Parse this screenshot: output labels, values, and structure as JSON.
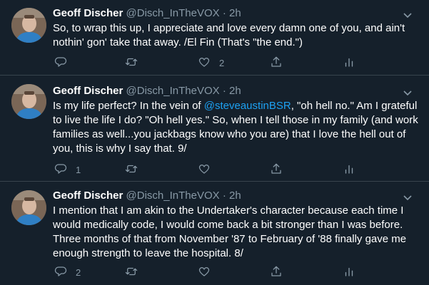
{
  "tweets": [
    {
      "name": "Geoff Discher",
      "handle": "@Disch_InTheVOX",
      "dot": "·",
      "time": "2h",
      "text": "So, to wrap this up, I appreciate and love every damn one of you, and ain't nothin' gon' take that away. /El Fin (That's \"the end.\")",
      "reply_count": "",
      "retweet_count": "",
      "like_count": "2"
    },
    {
      "name": "Geoff Discher",
      "handle": "@Disch_InTheVOX",
      "dot": "·",
      "time": "2h",
      "text_before": "Is my life perfect? In the vein of ",
      "mention": "@steveaustinBSR",
      "text_after": ", \"oh hell no.\" Am I grateful to live the life I do? \"Oh hell yes.\" So, when I tell those in my family (and work families as well...you jackbags know who you are) that I love the hell out of you, this is why I say that. 9/",
      "reply_count": "1",
      "retweet_count": "",
      "like_count": ""
    },
    {
      "name": "Geoff Discher",
      "handle": "@Disch_InTheVOX",
      "dot": "·",
      "time": "2h",
      "text": "I mention that I am akin to the Undertaker's character because each time I would medically code, I would come back a bit stronger than I was before. Three months of that from November '87 to February of '88 finally gave me enough strength to leave the hospital. 8/",
      "reply_count": "2",
      "retweet_count": "",
      "like_count": ""
    }
  ],
  "icons": {
    "reply": "reply-icon",
    "retweet": "retweet-icon",
    "like": "heart-icon",
    "share": "share-icon",
    "analytics": "analytics-icon",
    "more": "chevron-down-icon"
  },
  "colors": {
    "background": "#15202b",
    "text": "#ffffff",
    "muted": "#8899a6",
    "link": "#1da1f2",
    "divider": "#38444d"
  }
}
